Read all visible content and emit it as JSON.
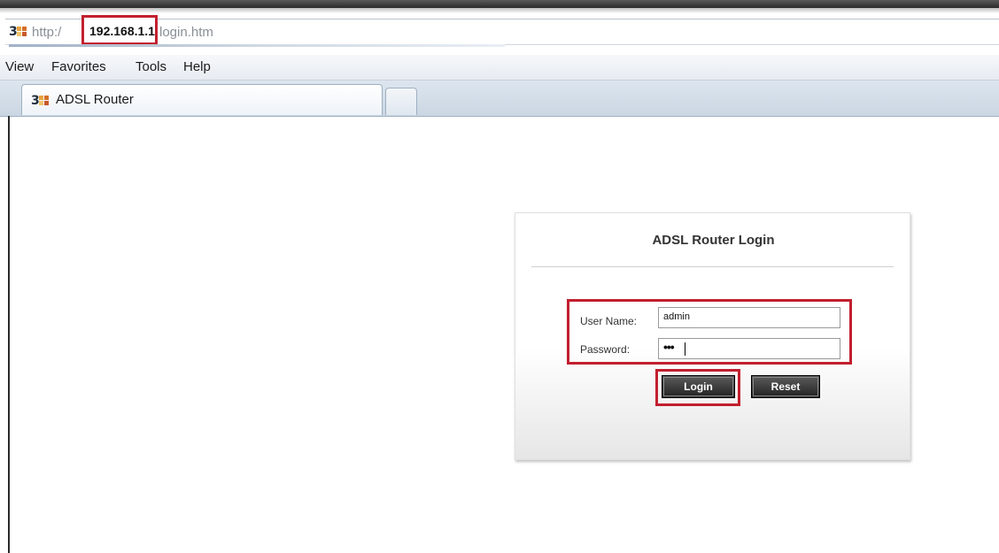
{
  "browser": {
    "address": {
      "prefix": "http:/",
      "host": "192.168.1.1",
      "path": "login.htm"
    },
    "favicon_glyph": "3",
    "menu": [
      "View",
      "Favorites",
      "Tools",
      "Help"
    ],
    "tab": {
      "label": "ADSL Router"
    }
  },
  "login": {
    "title": "ADSL Router Login",
    "username_label": "User Name:",
    "username_value": "admin",
    "password_label": "Password:",
    "password_mask": "•••",
    "login_button": "Login",
    "reset_button": "Reset"
  },
  "colors": {
    "highlight_red": "#c21f2f",
    "button_dark": "#333333"
  }
}
